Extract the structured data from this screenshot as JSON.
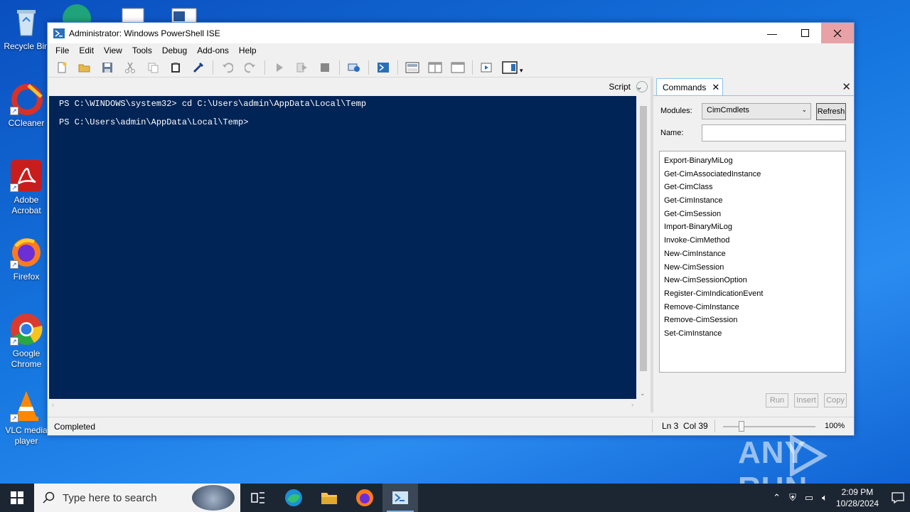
{
  "desktop": {
    "icons": [
      {
        "label": "Recycle Bin"
      },
      {
        "label": "CCleaner"
      },
      {
        "label": "Adobe Acrobat"
      },
      {
        "label": "Firefox"
      },
      {
        "label": "Google Chrome"
      },
      {
        "label": "VLC media player"
      }
    ]
  },
  "window": {
    "title": "Administrator: Windows PowerShell ISE",
    "menu": [
      "File",
      "Edit",
      "View",
      "Tools",
      "Debug",
      "Add-ons",
      "Help"
    ]
  },
  "script_pane": {
    "label": "Script"
  },
  "console": {
    "lines": [
      "PS C:\\WINDOWS\\system32> cd C:\\Users\\admin\\AppData\\Local\\Temp",
      "PS C:\\Users\\admin\\AppData\\Local\\Temp>"
    ]
  },
  "commands": {
    "tab_label": "Commands",
    "modules_label": "Modules:",
    "modules_value": "CimCmdlets",
    "refresh_label": "Refresh",
    "name_label": "Name:",
    "name_value": "",
    "items": [
      "Export-BinaryMiLog",
      "Get-CimAssociatedInstance",
      "Get-CimClass",
      "Get-CimInstance",
      "Get-CimSession",
      "Import-BinaryMiLog",
      "Invoke-CimMethod",
      "New-CimInstance",
      "New-CimSession",
      "New-CimSessionOption",
      "Register-CimIndicationEvent",
      "Remove-CimInstance",
      "Remove-CimSession",
      "Set-CimInstance"
    ],
    "run_label": "Run",
    "insert_label": "Insert",
    "copy_label": "Copy"
  },
  "status": {
    "text": "Completed",
    "position": "Ln 3  Col 39",
    "zoom": "100%"
  },
  "taskbar": {
    "search_placeholder": "Type here to search",
    "time": "2:09 PM",
    "date": "10/28/2024"
  },
  "watermark": "ANY RUN"
}
